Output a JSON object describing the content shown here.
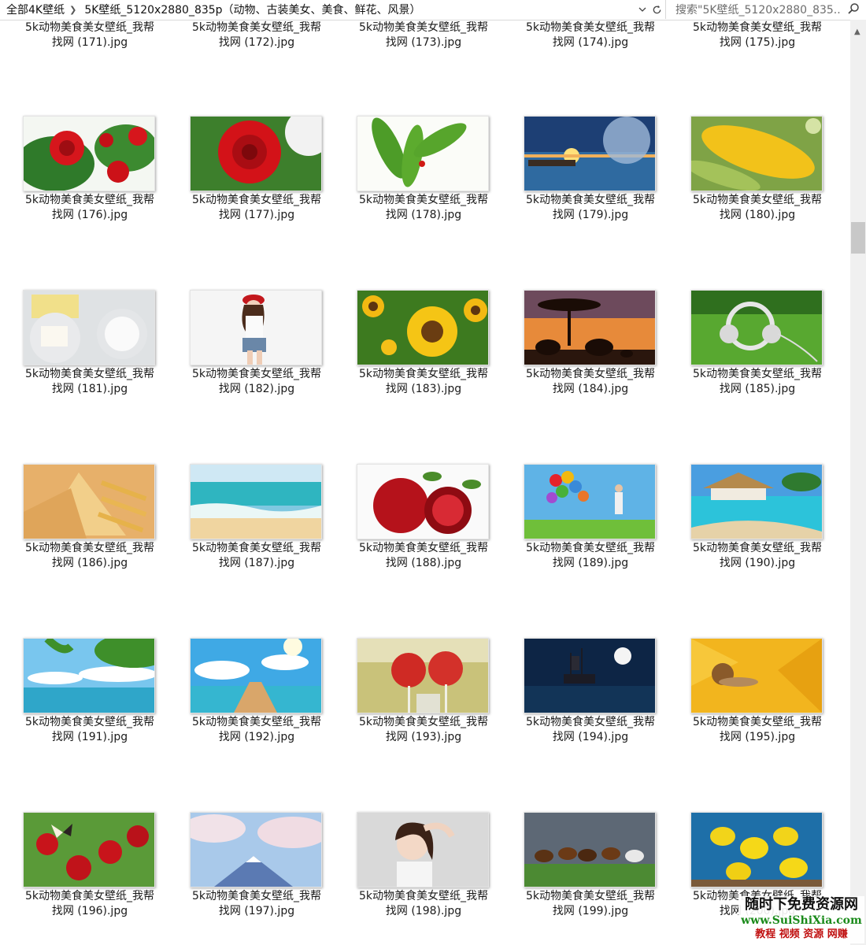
{
  "address": {
    "crumbs": [
      "全部4K壁纸",
      "5K壁纸_5120x2880_835p（动物、古装美女、美食、鲜花、风景）"
    ]
  },
  "search": {
    "placeholder": "搜索\"5K壁纸_5120x2880_835..."
  },
  "files": {
    "line1": "5k动物美食美女壁纸_我帮",
    "items": [
      {
        "name": "找网 (171).jpg",
        "thumb": "none"
      },
      {
        "name": "找网 (172).jpg",
        "thumb": "none"
      },
      {
        "name": "找网 (173).jpg",
        "thumb": "none"
      },
      {
        "name": "找网 (174).jpg",
        "thumb": "none"
      },
      {
        "name": "找网 (175).jpg",
        "thumb": "none"
      },
      {
        "name": "找网 (176).jpg",
        "thumb": "red-roses"
      },
      {
        "name": "找网 (177).jpg",
        "thumb": "red-rose"
      },
      {
        "name": "找网 (178).jpg",
        "thumb": "green-leaves"
      },
      {
        "name": "找网 (179).jpg",
        "thumb": "sunset-sea"
      },
      {
        "name": "找网 (180).jpg",
        "thumb": "corn"
      },
      {
        "name": "找网 (181).jpg",
        "thumb": "cheese"
      },
      {
        "name": "找网 (182).jpg",
        "thumb": "woman-red-cap"
      },
      {
        "name": "找网 (183).jpg",
        "thumb": "sunflowers"
      },
      {
        "name": "找网 (184).jpg",
        "thumb": "elephants-sunset"
      },
      {
        "name": "找网 (185).jpg",
        "thumb": "headphones-grass"
      },
      {
        "name": "找网 (186).jpg",
        "thumb": "samosa-fries"
      },
      {
        "name": "找网 (187).jpg",
        "thumb": "beach-wave"
      },
      {
        "name": "找网 (188).jpg",
        "thumb": "pomegranate"
      },
      {
        "name": "找网 (189).jpg",
        "thumb": "balloons-jump"
      },
      {
        "name": "找网 (190).jpg",
        "thumb": "resort-pool"
      },
      {
        "name": "找网 (191).jpg",
        "thumb": "palm-sea"
      },
      {
        "name": "找网 (192).jpg",
        "thumb": "pier-sky"
      },
      {
        "name": "找网 (193).jpg",
        "thumb": "red-candies"
      },
      {
        "name": "找网 (194).jpg",
        "thumb": "ship-moon"
      },
      {
        "name": "找网 (195).jpg",
        "thumb": "snail-flower"
      },
      {
        "name": "找网 (196).jpg",
        "thumb": "butterfly-berries"
      },
      {
        "name": "找网 (197).jpg",
        "thumb": "fuji-blossom"
      },
      {
        "name": "找网 (198).jpg",
        "thumb": "woman-portrait"
      },
      {
        "name": "找网 (199).jpg",
        "thumb": "horses"
      },
      {
        "name": "找网 (200).jpg",
        "thumb": "yellow-fish"
      }
    ]
  },
  "watermark": {
    "line1": "随时下免费资源网",
    "line2": "www.SuiShiXia.com",
    "line3": "教程 视频 资源 网赚"
  },
  "icons": {
    "dropdown": "chevron-down-icon",
    "refresh": "refresh-icon",
    "search": "search-icon",
    "separator": "chevron-right-icon"
  }
}
